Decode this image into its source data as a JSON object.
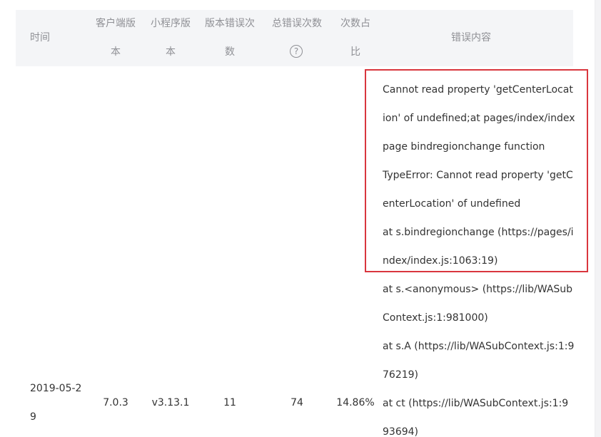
{
  "header": {
    "time": "时间",
    "client_version": [
      "客户端版",
      "本"
    ],
    "miniprogram_version": [
      "小程序版",
      "本"
    ],
    "version_errors": [
      "版本错误次",
      "数"
    ],
    "total_errors": "总错误次数",
    "total_errors_help_icon": "?",
    "ratio": [
      "次数占",
      "比"
    ],
    "error_content": "错误内容"
  },
  "row": {
    "time": [
      "2019-05-2",
      "9"
    ],
    "client_version": "7.0.3",
    "miniprogram_version": "v3.13.1",
    "version_errors": "11",
    "total_errors": "74",
    "ratio": "14.86%",
    "error_lines": [
      "Cannot read property 'getCenterLocat",
      "ion' of undefined;at pages/index/index",
      "page bindregionchange function",
      "TypeError: Cannot read property 'getC",
      "enterLocation' of undefined",
      "at s.bindregionchange (https://pages/i",
      "ndex/index.js:1063:19)",
      "at s.<anonymous> (https://lib/WASub",
      "Context.js:1:981000)",
      "at s.A (https://lib/WASubContext.js:1:9",
      "76219)",
      "at ct (https://lib/WASubContext.js:1:9",
      "93694)"
    ]
  },
  "colors": {
    "header_bg": "#f4f5f7",
    "header_text": "#8f9095",
    "body_text": "#333333",
    "highlight": "#d9363e"
  }
}
